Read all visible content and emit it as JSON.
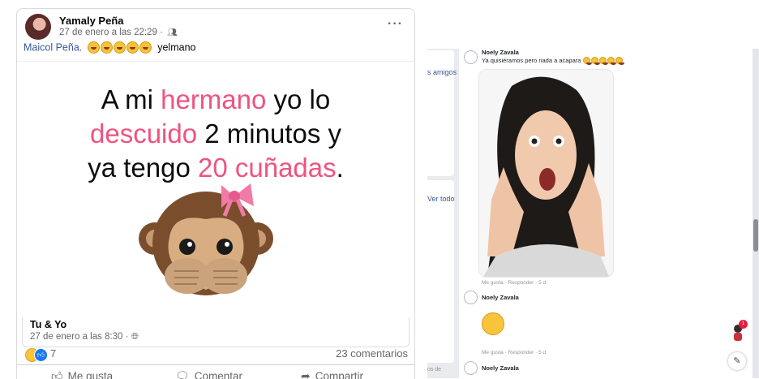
{
  "post": {
    "author": "Yamaly Peña",
    "date": "27 de enero a las 22:29 ·",
    "caption_tag": "Maicol Peña.",
    "caption_rest": "yelmano",
    "meme": {
      "line1_a": "A mi ",
      "line1_b": "hermano",
      "line1_c": " yo lo",
      "line2_a": "descuido",
      "line2_b": " 2 minutos y",
      "line3_a": "ya tengo ",
      "line3_b": "20 cuñadas",
      "line3_c": "."
    },
    "shared": {
      "name": "Tu & Yo",
      "date": "27 de enero a las 8:30 ·"
    },
    "reaction_count": "7",
    "comments_count": "23 comentarios",
    "actions": {
      "like": "Me gusta",
      "comment": "Comentar",
      "share": "Compartir"
    }
  },
  "strip": {
    "link1": "s amigos",
    "link2": "Ver todo",
    "footer": "os de"
  },
  "comments": [
    {
      "name": "Noely Zavala",
      "text": "Ya quisiéramos pero nada a acapara",
      "meta": ""
    },
    {
      "name": "",
      "text": "",
      "meta": "Me gusta · Responder · 5 d"
    },
    {
      "name": "Noely Zavala",
      "text": "",
      "meta": "Me gusta · Responder · 5 d"
    },
    {
      "name": "Noely Zavala",
      "text": "",
      "meta": ""
    }
  ],
  "chat": {
    "badge": "1"
  },
  "colors": {
    "accent_pink": "#f0537e",
    "link_blue": "#385898",
    "fb_blue": "#1877f2"
  },
  "icons": [
    "people-icon",
    "more-icon",
    "like-icon",
    "comment-icon",
    "share-icon",
    "globe-icon",
    "compose-icon"
  ]
}
